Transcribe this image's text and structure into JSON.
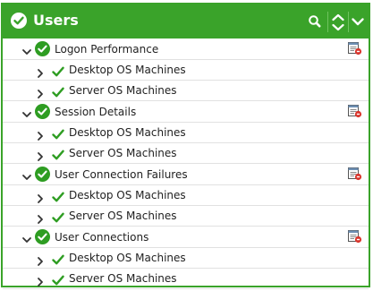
{
  "header": {
    "title": "Users",
    "icons": [
      "check-circle-icon",
      "search-icon",
      "sort-icon",
      "chevron-down-icon"
    ]
  },
  "groups": [
    {
      "label": "Logon Performance",
      "children": [
        {
          "label": "Desktop OS Machines"
        },
        {
          "label": "Server OS Machines"
        }
      ]
    },
    {
      "label": "Session Details",
      "children": [
        {
          "label": "Desktop OS Machines"
        },
        {
          "label": "Server OS Machines"
        }
      ]
    },
    {
      "label": "User Connection Failures",
      "children": [
        {
          "label": "Desktop OS Machines"
        },
        {
          "label": "Server OS Machines"
        }
      ]
    },
    {
      "label": "User Connections",
      "children": [
        {
          "label": "Desktop OS Machines"
        },
        {
          "label": "Server OS Machines"
        }
      ]
    }
  ],
  "colors": {
    "header_bg": "#3aa32a",
    "check_green": "#2e9d22",
    "row_divider": "#e1e1e1",
    "report_red": "#d9342b"
  }
}
